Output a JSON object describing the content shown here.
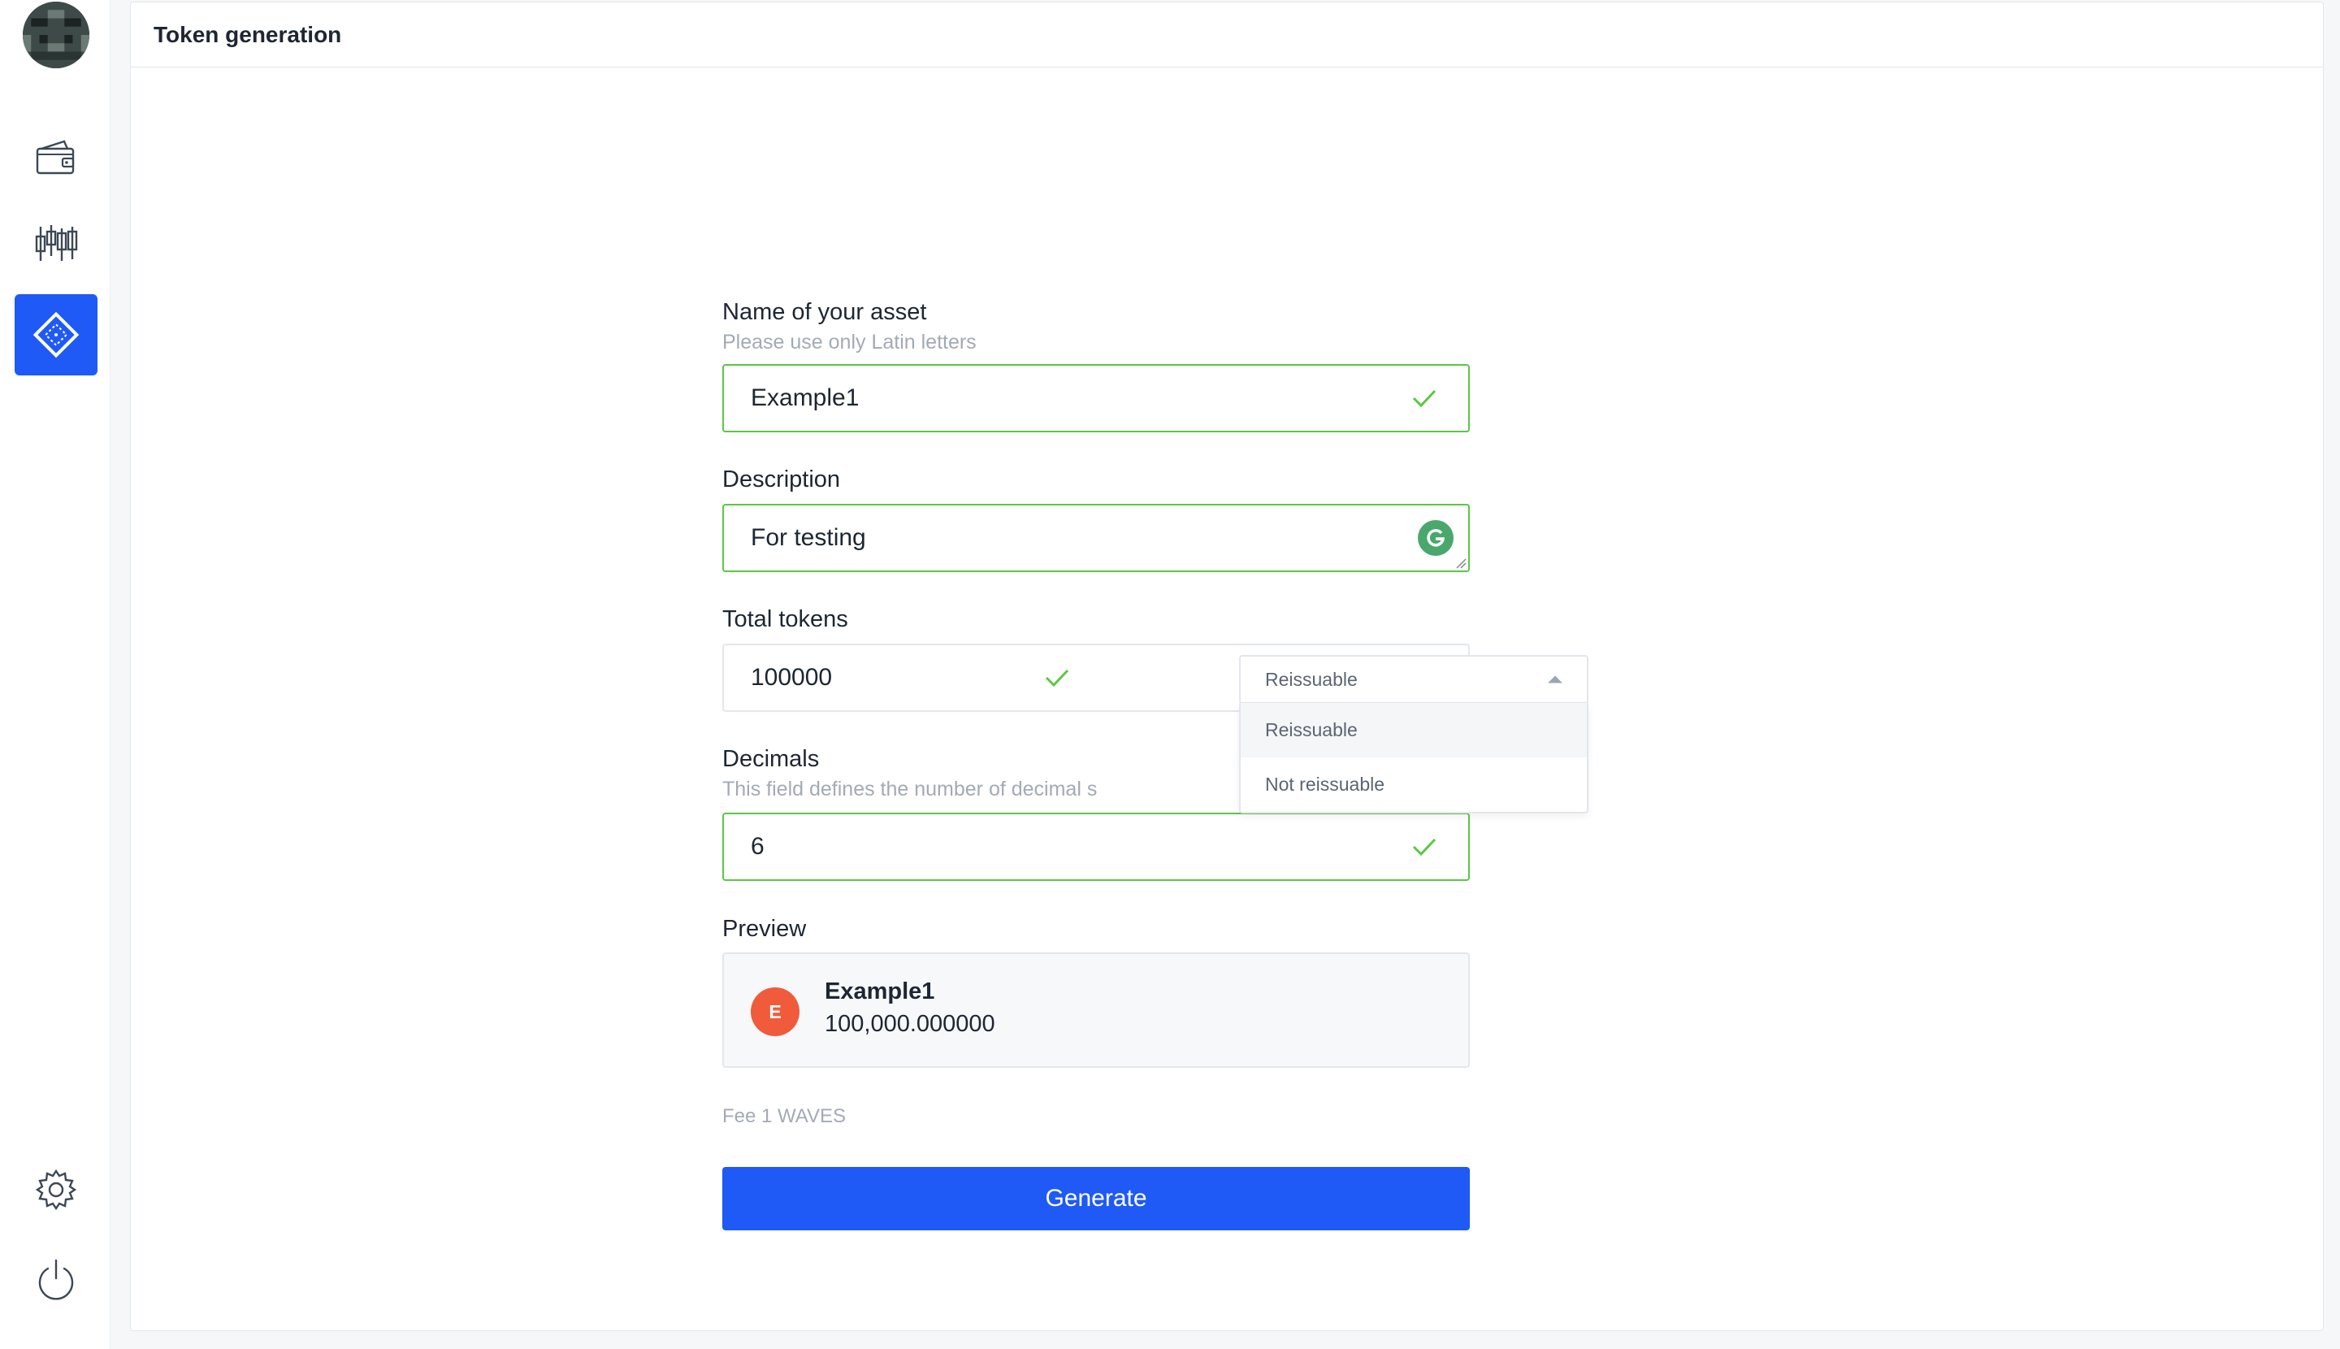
{
  "sidebar": {
    "items": [
      {
        "icon": "wallet-icon"
      },
      {
        "icon": "candlestick-chart-icon"
      },
      {
        "icon": "token-diamond-icon",
        "active": true
      },
      {
        "icon": "gear-icon"
      },
      {
        "icon": "power-icon"
      }
    ],
    "active_color": "#1f5af6"
  },
  "header": {
    "title": "Token generation"
  },
  "form": {
    "name": {
      "label": "Name of your asset",
      "hint": "Please use only Latin letters",
      "value": "Example1"
    },
    "description": {
      "label": "Description",
      "value": "For testing"
    },
    "total_tokens": {
      "label": "Total tokens",
      "value": "100000",
      "reissue_select": {
        "selected": "Reissuable",
        "options": [
          "Reissuable",
          "Not reissuable"
        ]
      }
    },
    "decimals": {
      "label": "Decimals",
      "hint": "This field defines the number of decimal s",
      "value": "6"
    },
    "preview": {
      "label": "Preview",
      "badge_letter": "E",
      "token_name": "Example1",
      "amount": "100,000.000000"
    },
    "fee": "Fee 1 WAVES",
    "generate_label": "Generate"
  },
  "colors": {
    "accent": "#1f5af6",
    "valid_border": "#5ac843",
    "badge": "#ef5b3b"
  }
}
